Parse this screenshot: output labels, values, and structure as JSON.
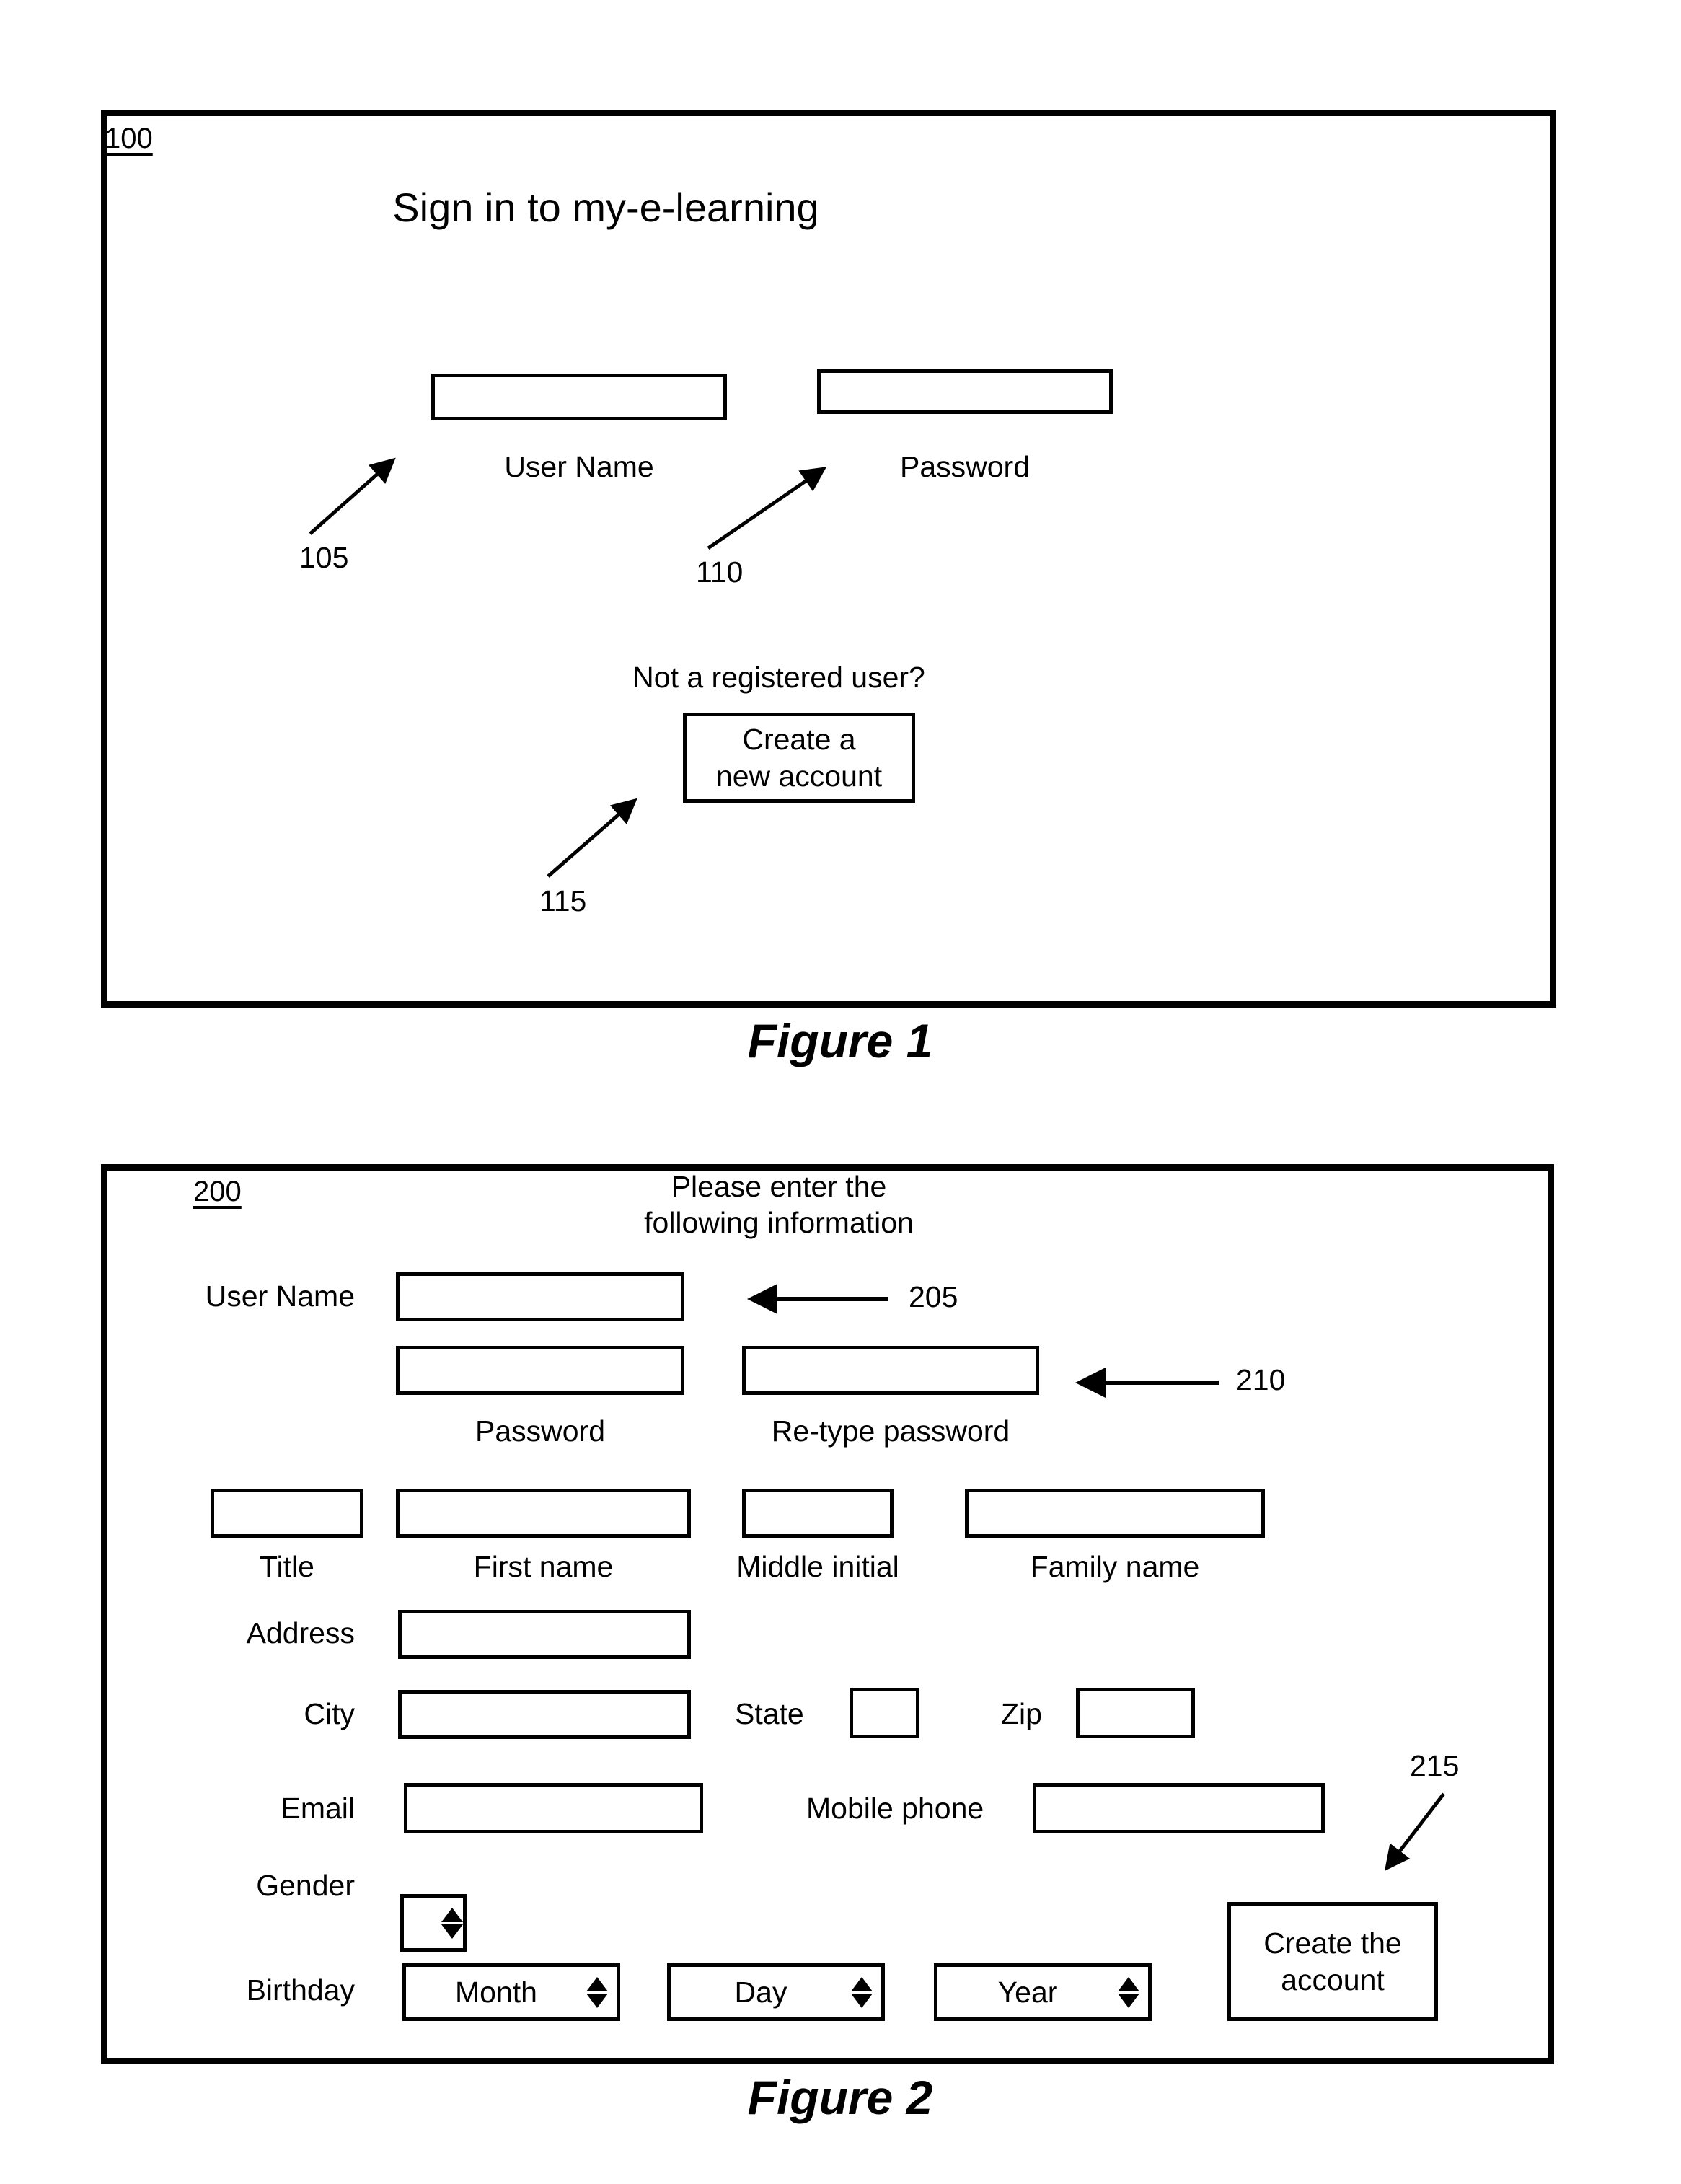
{
  "page": {
    "background": "#ffffff",
    "ink": "#000000"
  },
  "figure1": {
    "ref_id": "100",
    "caption": "Figure 1",
    "title": "Sign in to my-e-learning",
    "username_label": "User Name",
    "password_label": "Password",
    "prompt": "Not a registered user?",
    "create_button": {
      "line1": "Create a",
      "line2": "new account"
    },
    "callouts": [
      {
        "number": "105",
        "points_to": "user-name-field"
      },
      {
        "number": "110",
        "points_to": "password-field"
      },
      {
        "number": "115",
        "points_to": "create-new-account-button"
      }
    ]
  },
  "figure2": {
    "ref_id": "200",
    "caption": "Figure 2",
    "heading_line1": "Please enter the",
    "heading_line2": "following information",
    "labels": {
      "username": "User Name",
      "password": "Password",
      "retype_password": "Re-type password",
      "title": "Title",
      "first_name": "First name",
      "middle_initial": "Middle initial",
      "family_name": "Family name",
      "address": "Address",
      "city": "City",
      "state": "State",
      "zip": "Zip",
      "email": "Email",
      "mobile_phone": "Mobile phone",
      "gender": "Gender",
      "birthday": "Birthday"
    },
    "spinners": {
      "gender_value": "",
      "month_value": "Month",
      "day_value": "Day",
      "year_value": "Year"
    },
    "create_button": {
      "line1": "Create the",
      "line2": "account"
    },
    "callouts": [
      {
        "number": "205",
        "points_to": "user-name-field"
      },
      {
        "number": "210",
        "points_to": "retype-password-field"
      },
      {
        "number": "215",
        "points_to": "create-the-account-button"
      }
    ]
  }
}
